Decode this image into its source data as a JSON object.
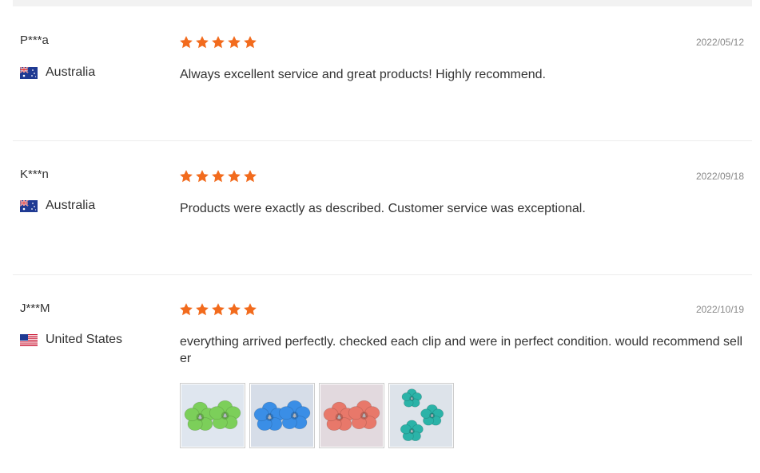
{
  "reviews": [
    {
      "user": "P***a",
      "country": "Australia",
      "flag": "flag-au-icon",
      "date": "2022/05/12",
      "rating": 5,
      "text": "Always excellent service and great products! Highly recommend."
    },
    {
      "user": "K***n",
      "country": "Australia",
      "flag": "flag-au-icon",
      "date": "2022/09/18",
      "rating": 5,
      "text": "Products were exactly as described. Customer service was exceptional."
    },
    {
      "user": "J***M",
      "country": "United States",
      "flag": "flag-us-icon",
      "date": "2022/10/19",
      "rating": 5,
      "text": "everything arrived perfectly. checked each clip and were in perfect condition. would recommend seller",
      "photos": [
        {
          "name": "green-flower-clip-photo",
          "color": "#7ccf5a",
          "bg": "#dfe6ef"
        },
        {
          "name": "blue-flower-clip-photo",
          "color": "#3a8ee6",
          "bg": "#d6dde8"
        },
        {
          "name": "coral-flower-clip-photo",
          "color": "#e8786a",
          "bg": "#e2d9de"
        },
        {
          "name": "teal-flower-clip-photo",
          "color": "#2bb3a8",
          "bg": "#dde3ea"
        }
      ]
    }
  ],
  "colors": {
    "star": "#f26b1d",
    "divider": "#ececec"
  }
}
